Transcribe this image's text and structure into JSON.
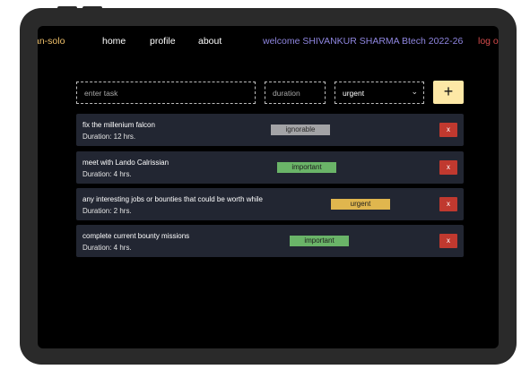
{
  "nav": {
    "brand": "an-solo",
    "links": [
      "home",
      "profile",
      "about"
    ],
    "welcome": "welcome SHIVANKUR SHARMA Btech 2022-26",
    "logout": "log o"
  },
  "form": {
    "task_placeholder": "enter task",
    "duration_placeholder": "duration",
    "priority_selected": "urgent",
    "add_label": "+"
  },
  "tasks": [
    {
      "title": "fix the millenium falcon",
      "duration": "Duration: 12 hrs.",
      "priority": "ignorable",
      "delete_label": "x"
    },
    {
      "title": "meet with Lando Calrissian",
      "duration": "Duration: 4 hrs.",
      "priority": "important",
      "delete_label": "x"
    },
    {
      "title": "any interesting jobs or bounties that could be worth while",
      "duration": "Duration: 2 hrs.",
      "priority": "urgent",
      "delete_label": "x"
    },
    {
      "title": "complete current bounty missions",
      "duration": "Duration: 4 hrs.",
      "priority": "important",
      "delete_label": "x"
    }
  ],
  "colors": {
    "ignorable": "#a3a3a6",
    "important": "#6ab468",
    "urgent": "#e0b64e",
    "delete": "#c0392f",
    "add_button": "#fde8a6"
  }
}
